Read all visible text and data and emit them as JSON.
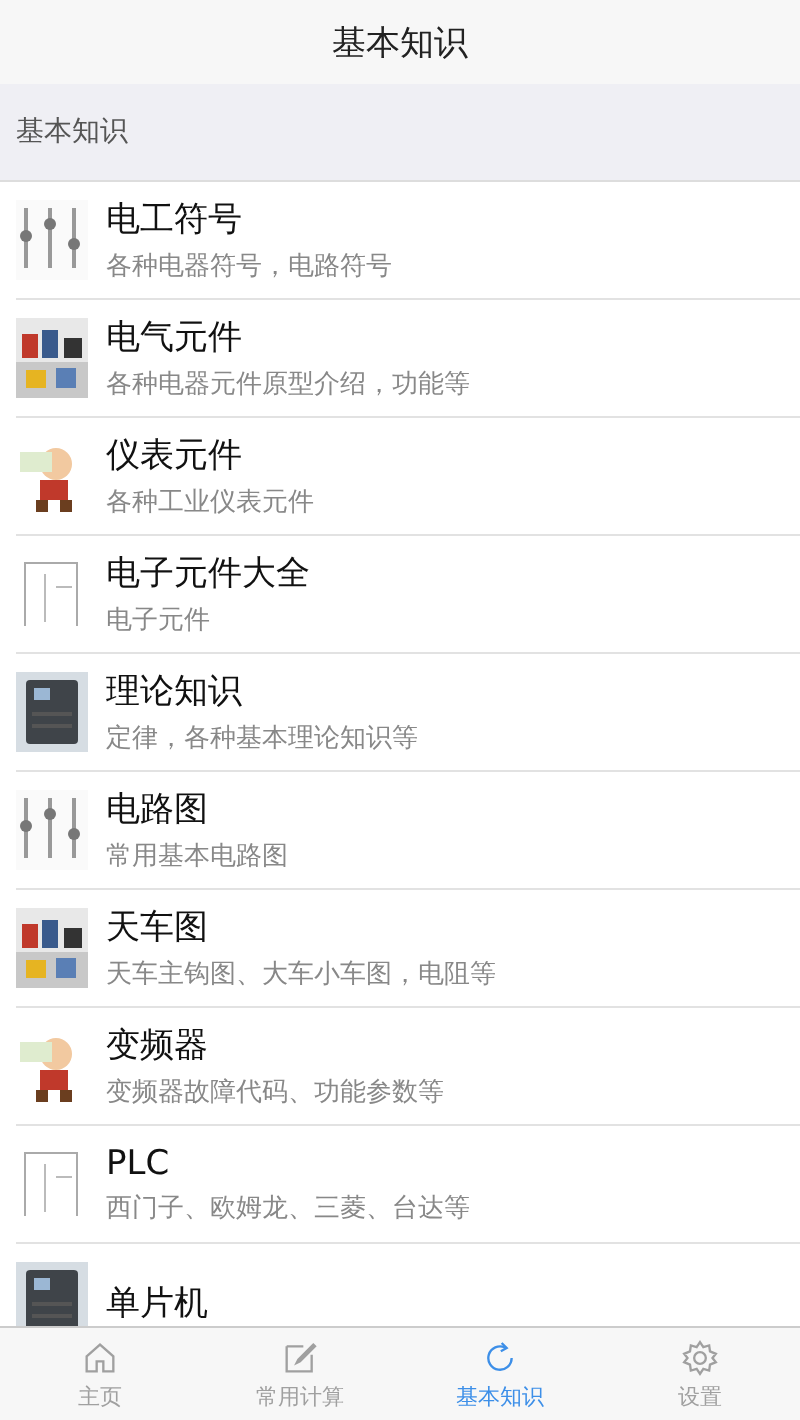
{
  "header": {
    "title": "基本知识"
  },
  "section": {
    "title": "基本知识"
  },
  "items": [
    {
      "title": "电工符号",
      "subtitle": "各种电器符号，电路符号"
    },
    {
      "title": "电气元件",
      "subtitle": "各种电器元件原型介绍，功能等"
    },
    {
      "title": "仪表元件",
      "subtitle": "各种工业仪表元件"
    },
    {
      "title": "电子元件大全",
      "subtitle": "电子元件"
    },
    {
      "title": "理论知识",
      "subtitle": "定律，各种基本理论知识等"
    },
    {
      "title": "电路图",
      "subtitle": "常用基本电路图"
    },
    {
      "title": "天车图",
      "subtitle": "天车主钩图、大车小车图，电阻等"
    },
    {
      "title": "变频器",
      "subtitle": "变频器故障代码、功能参数等"
    },
    {
      "title": "PLC",
      "subtitle": "西门子、欧姆龙、三菱、台达等"
    },
    {
      "title": "单片机"
    }
  ],
  "tabs": [
    {
      "label": "主页",
      "selected": false
    },
    {
      "label": "常用计算",
      "selected": false
    },
    {
      "label": "基本知识",
      "selected": true
    },
    {
      "label": "设置",
      "selected": false
    }
  ]
}
